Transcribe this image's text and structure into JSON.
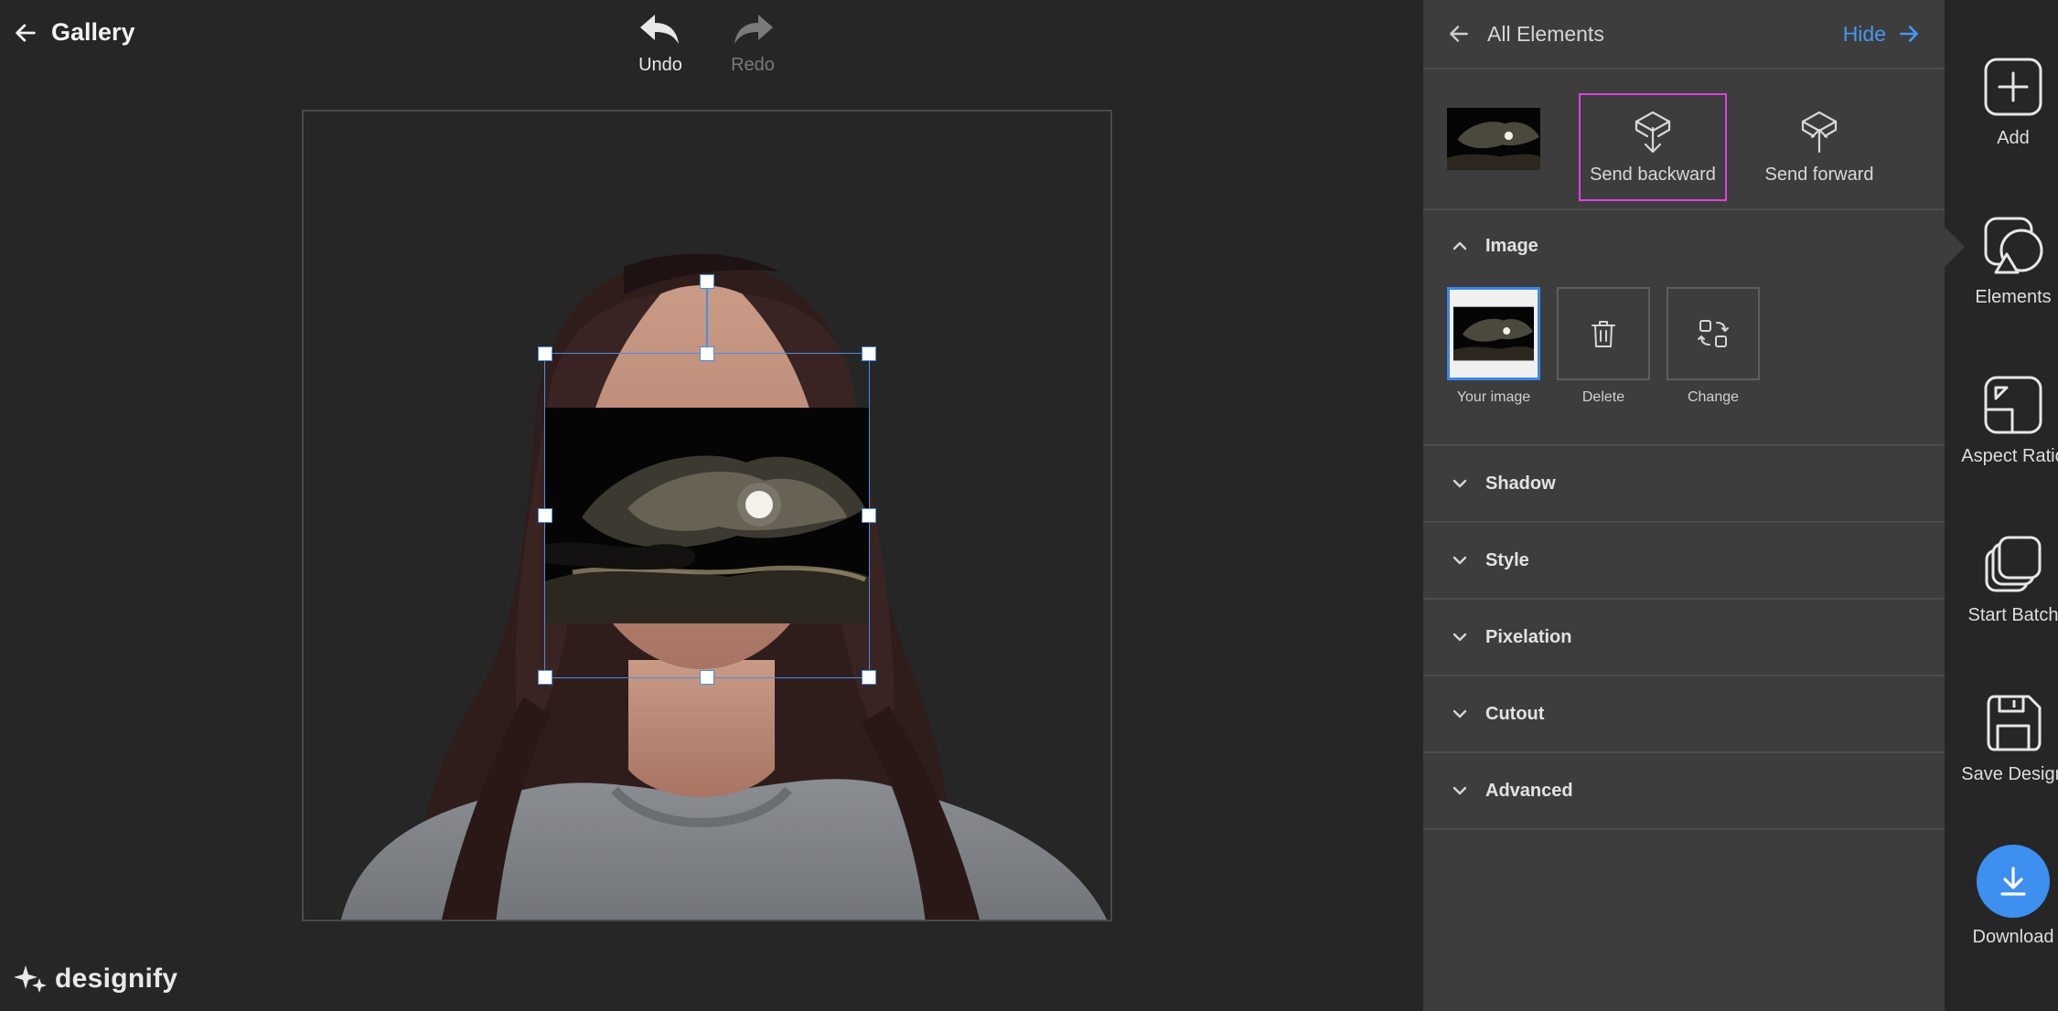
{
  "topbar": {
    "back_label": "Gallery",
    "undo_label": "Undo",
    "redo_label": "Redo"
  },
  "brand": {
    "name": "designify"
  },
  "panel": {
    "title": "All Elements",
    "hide_label": "Hide",
    "layer_actions": {
      "send_backward": "Send backward",
      "send_forward": "Send forward"
    },
    "image_section": {
      "title": "Image",
      "tools": {
        "your_image": "Your image",
        "delete": "Delete",
        "change": "Change"
      }
    },
    "sections": [
      "Shadow",
      "Style",
      "Pixelation",
      "Cutout",
      "Advanced"
    ]
  },
  "sidebar": {
    "add": "Add",
    "elements": "Elements",
    "aspect_ratio": "Aspect Ratio",
    "start_batch": "Start Batch",
    "save_design": "Save Design",
    "download": "Download"
  },
  "colors": {
    "accent": "#3d8ff0",
    "highlight": "#e040e6",
    "selection": "#4a8fe0"
  }
}
